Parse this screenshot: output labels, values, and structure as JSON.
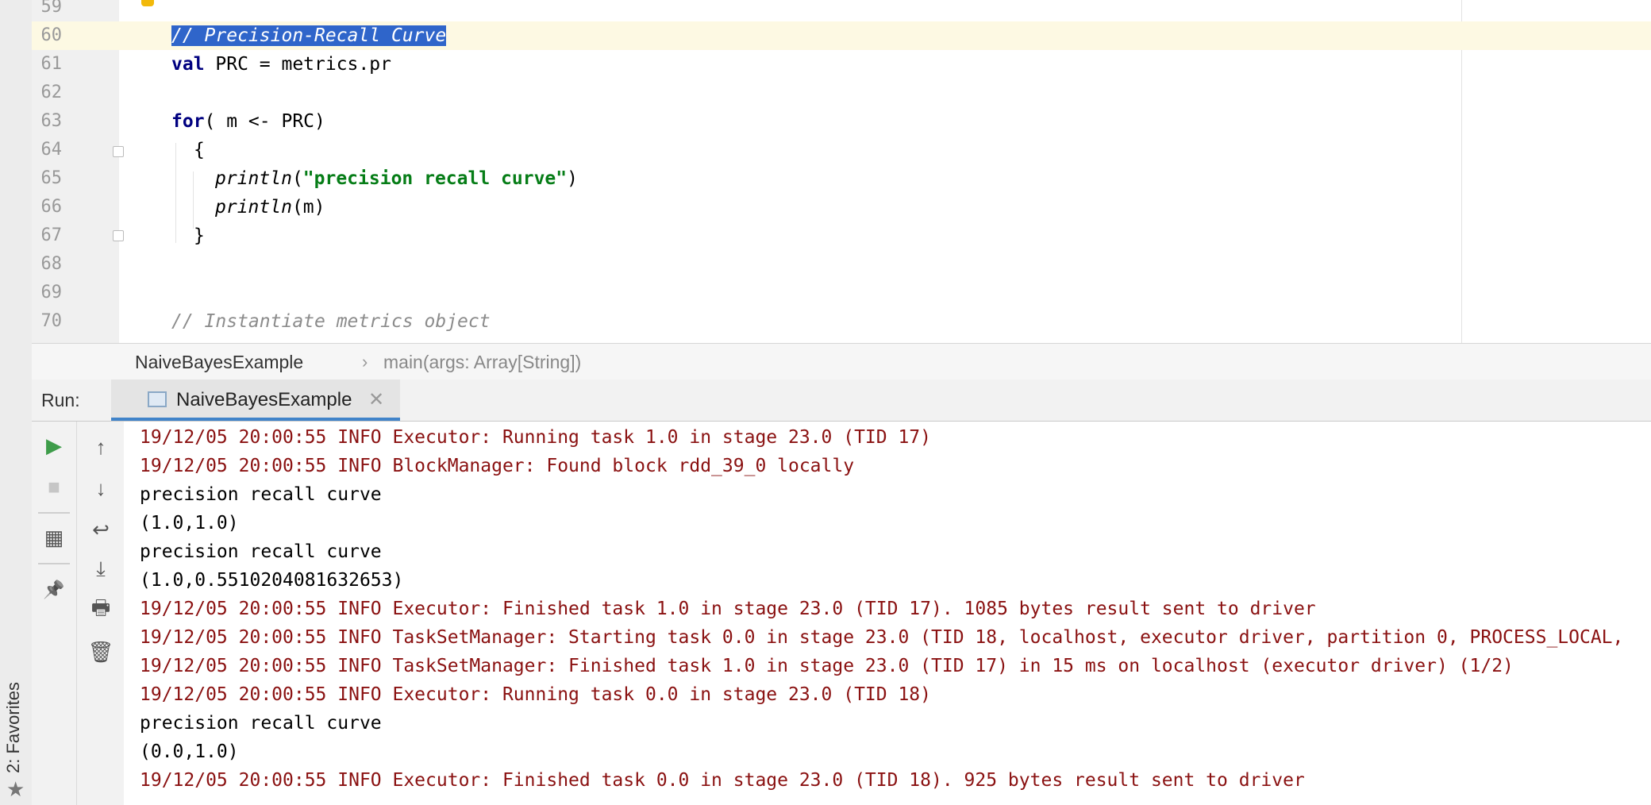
{
  "favorites": {
    "label": "2: Favorites"
  },
  "editor": {
    "lines": [
      {
        "num": "59"
      },
      {
        "num": "60",
        "comment": "// Precision-Recall Curve"
      },
      {
        "num": "61",
        "kw": "val",
        "rest": " PRC = metrics.pr"
      },
      {
        "num": "62"
      },
      {
        "num": "63",
        "kw": "for",
        "rest": "( m <- PRC)"
      },
      {
        "num": "64",
        "rest": "{"
      },
      {
        "num": "65",
        "fn": "println",
        "open": "(",
        "str": "\"precision recall curve\"",
        "close": ")"
      },
      {
        "num": "66",
        "fn": "println",
        "rest": "(m)"
      },
      {
        "num": "67",
        "rest": "}"
      },
      {
        "num": "68"
      },
      {
        "num": "69"
      },
      {
        "num": "70",
        "comment": "// Instantiate metrics object"
      }
    ]
  },
  "breadcrumb": {
    "class": "NaiveBayesExample",
    "separator": "›",
    "method": "main(args: Array[String])"
  },
  "run": {
    "label": "Run:",
    "tab_label": "NaiveBayesExample",
    "close": "✕"
  },
  "toolbar": {
    "rerun": "▶",
    "stop": "■",
    "layout": "▦",
    "pin": "📌",
    "up": "↑",
    "down": "↓",
    "wrap": "↩",
    "scroll_end": "⤓",
    "print": "🖶",
    "trash": "🗑"
  },
  "console": {
    "lines": [
      {
        "kind": "err",
        "text": "19/12/05 20:00:55 INFO Executor: Running task 1.0 in stage 23.0 (TID 17)"
      },
      {
        "kind": "err",
        "text": "19/12/05 20:00:55 INFO BlockManager: Found block rdd_39_0 locally"
      },
      {
        "kind": "out",
        "text": "precision recall curve"
      },
      {
        "kind": "out",
        "text": "(1.0,1.0)"
      },
      {
        "kind": "out",
        "text": "precision recall curve"
      },
      {
        "kind": "out",
        "text": "(1.0,0.5510204081632653)"
      },
      {
        "kind": "err",
        "text": "19/12/05 20:00:55 INFO Executor: Finished task 1.0 in stage 23.0 (TID 17). 1085 bytes result sent to driver"
      },
      {
        "kind": "err",
        "text": "19/12/05 20:00:55 INFO TaskSetManager: Starting task 0.0 in stage 23.0 (TID 18, localhost, executor driver, partition 0, PROCESS_LOCAL,"
      },
      {
        "kind": "err",
        "text": "19/12/05 20:00:55 INFO TaskSetManager: Finished task 1.0 in stage 23.0 (TID 17) in 15 ms on localhost (executor driver) (1/2)"
      },
      {
        "kind": "err",
        "text": "19/12/05 20:00:55 INFO Executor: Running task 0.0 in stage 23.0 (TID 18)"
      },
      {
        "kind": "out",
        "text": "precision recall curve"
      },
      {
        "kind": "out",
        "text": "(0.0,1.0)"
      },
      {
        "kind": "err",
        "text": "19/12/05 20:00:55 INFO Executor: Finished task 0.0 in stage 23.0 (TID 18). 925 bytes result sent to driver"
      }
    ]
  }
}
